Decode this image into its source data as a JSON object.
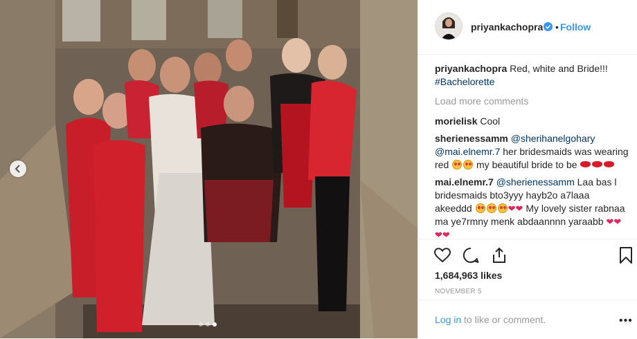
{
  "post": {
    "username": "priyankachopra",
    "separator": "•",
    "follow_label": "Follow",
    "caption": {
      "user": "priyankachopra",
      "text": "Red, white and Bride!!!",
      "hashtag": "#Bachelorette"
    },
    "load_more_label": "Load more comments",
    "comments": [
      {
        "user": "morielisk",
        "text": "Cool"
      },
      {
        "user": "sherienessamm",
        "mention1": "@sherihanelgohary",
        "mention2": "@mai.elnemr.7",
        "text1": "her bridesmaids was wearing red",
        "text2": "my beautiful bride to be"
      },
      {
        "user": "mai.elnemr.7",
        "mention": "@sherienessamm",
        "text1": "Laa bas l bridesmaids bto3yyy hayb2o a7laaa akeeddd",
        "text2": "My lovely sister rabnaa ma ye7rmny menk abdaannnn yaraabb"
      }
    ],
    "likes": "1,684,963 likes",
    "date": "NOVEMBER 5",
    "login_link": "Log in",
    "login_text": "to like or comment.",
    "more_label": "•••"
  },
  "carousel": {
    "total": 3,
    "active_index": 2
  },
  "icons": {
    "verified": "verified-badge-icon",
    "like": "heart-icon",
    "comment": "comment-bubble-icon",
    "share": "share-icon",
    "save": "bookmark-icon",
    "prev": "chevron-left-icon"
  },
  "colors": {
    "accent": "#3897f0",
    "muted": "#999999",
    "text": "#262626",
    "hashtag": "#003569"
  }
}
